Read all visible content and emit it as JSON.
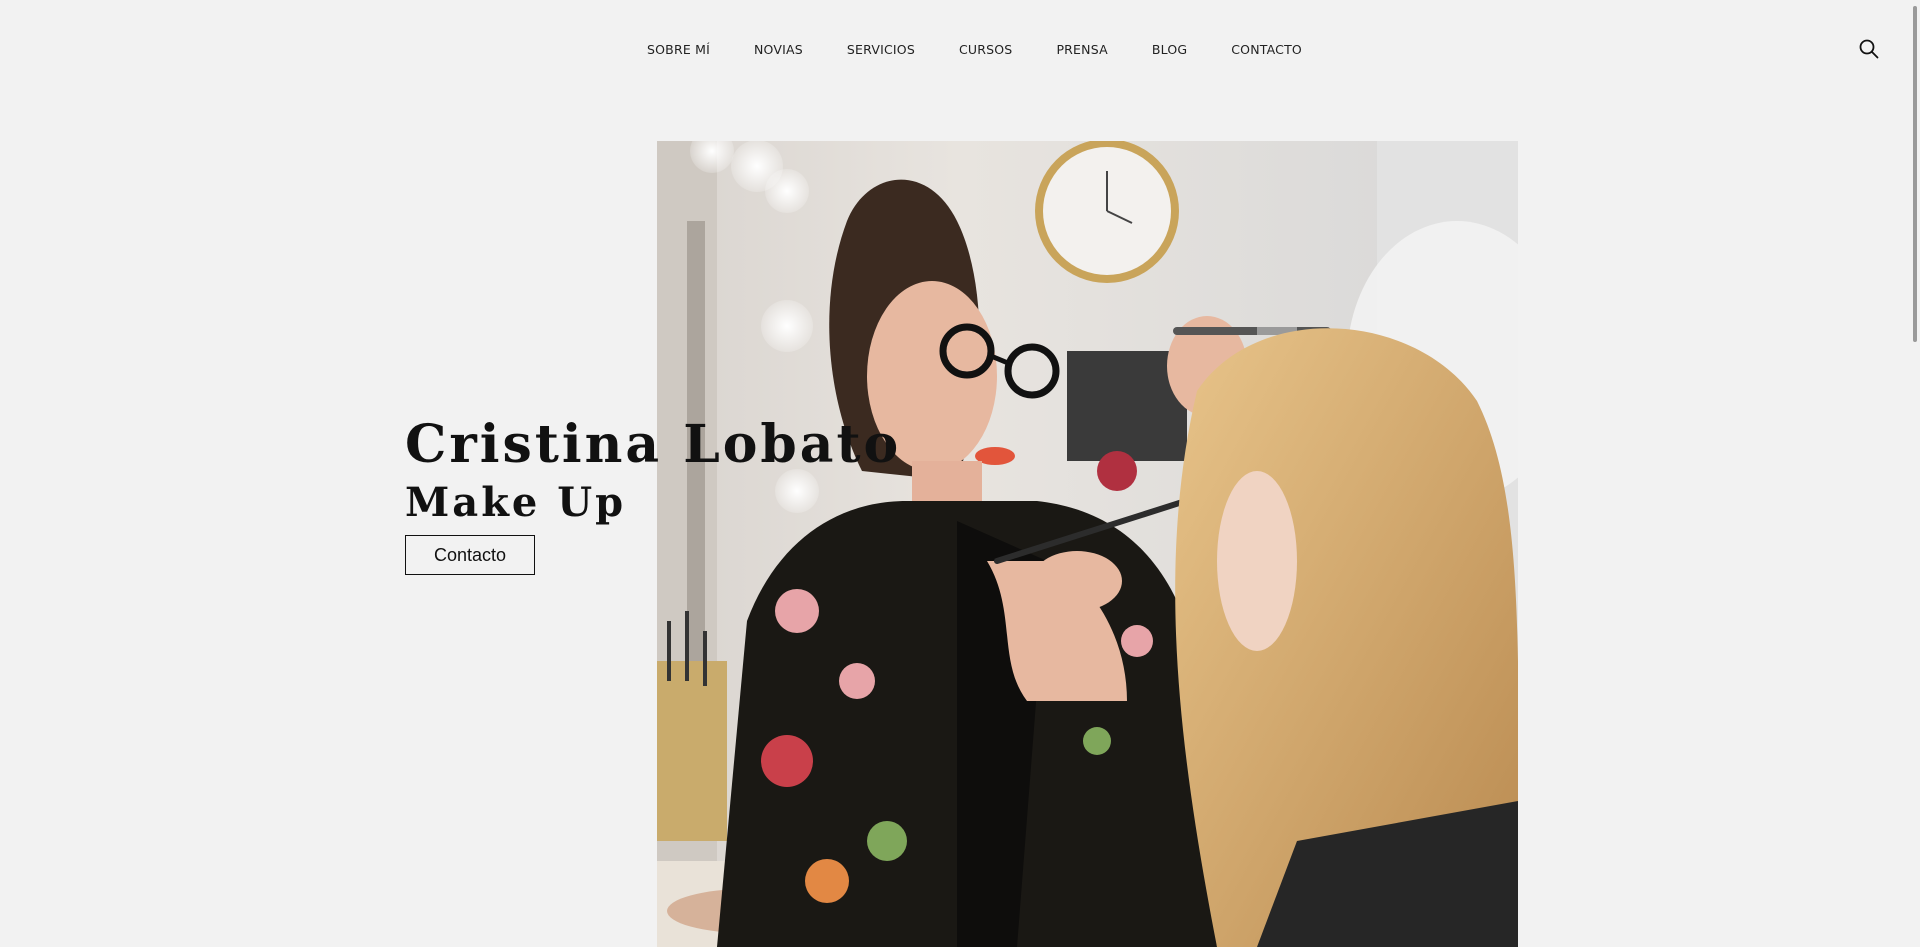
{
  "nav": {
    "items": [
      {
        "label": "SOBRE MÍ"
      },
      {
        "label": "NOVIAS"
      },
      {
        "label": "SERVICIOS"
      },
      {
        "label": "CURSOS"
      },
      {
        "label": "PRENSA"
      },
      {
        "label": "BLOG"
      },
      {
        "label": "CONTACTO"
      }
    ],
    "search_icon": "search-icon"
  },
  "hero": {
    "title": "Cristina Lobato",
    "subtitle": "Make Up",
    "cta_label": "Contacto",
    "image": "makeup-artist-photo"
  },
  "colors": {
    "background": "#f2f2f2",
    "text": "#111111"
  }
}
